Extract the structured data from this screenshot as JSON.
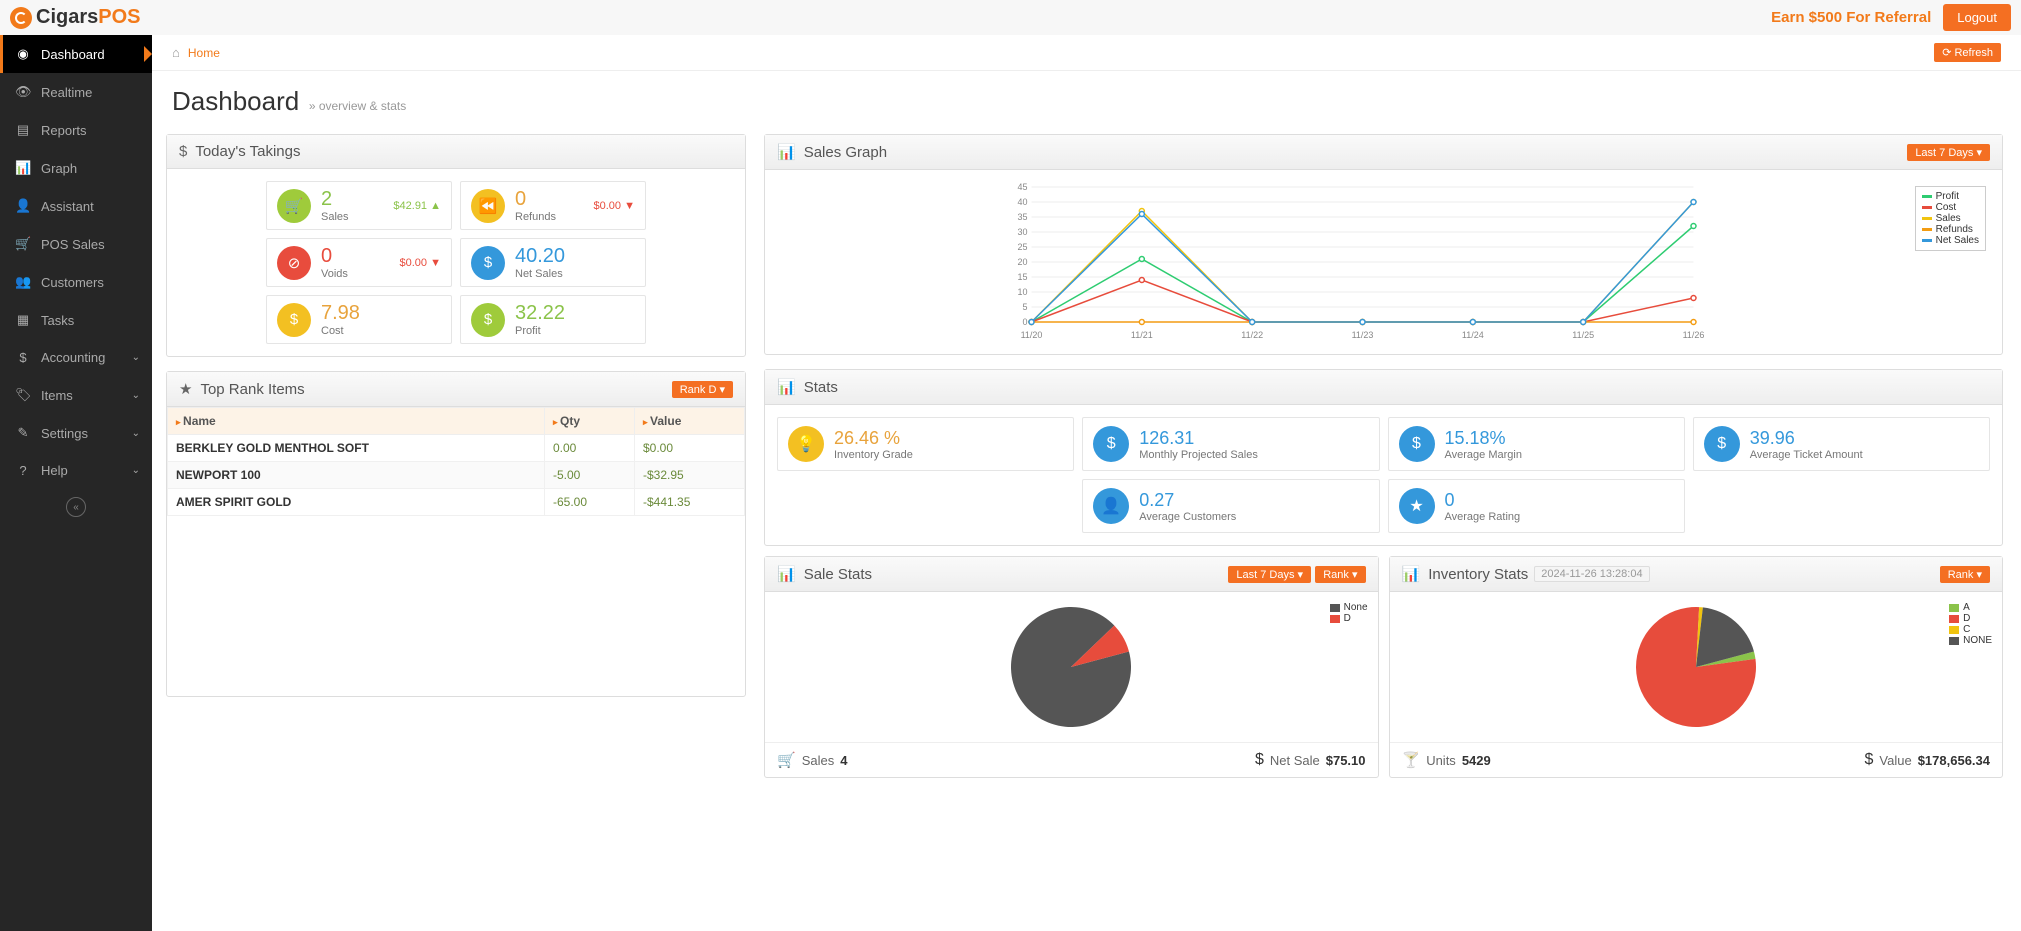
{
  "brand": {
    "text1": "Cigars",
    "text2": "POS"
  },
  "topbar": {
    "referral": "Earn $500 For Referral",
    "logout": "Logout"
  },
  "breadcrumb": {
    "home": "Home"
  },
  "refresh_label": "Refresh",
  "page": {
    "title": "Dashboard",
    "subtitle": "» overview & stats"
  },
  "sidebar": {
    "items": [
      {
        "icon": "dashboard",
        "label": "Dashboard",
        "active": true
      },
      {
        "icon": "eye",
        "label": "Realtime"
      },
      {
        "icon": "report",
        "label": "Reports"
      },
      {
        "icon": "bars",
        "label": "Graph"
      },
      {
        "icon": "user",
        "label": "Assistant"
      },
      {
        "icon": "cart",
        "label": "POS Sales"
      },
      {
        "icon": "users",
        "label": "Customers"
      },
      {
        "icon": "tasks",
        "label": "Tasks"
      },
      {
        "icon": "dollar",
        "label": "Accounting",
        "chev": true
      },
      {
        "icon": "tag",
        "label": "Items",
        "chev": true
      },
      {
        "icon": "edit",
        "label": "Settings",
        "chev": true
      },
      {
        "icon": "help",
        "label": "Help",
        "chev": true
      }
    ]
  },
  "takings": {
    "title": "Today's Takings",
    "tiles": [
      {
        "ico": "cart",
        "ico_cls": "ico-green",
        "val": "2",
        "val_cls": "val-green",
        "lbl": "Sales",
        "side": "$42.91",
        "side_cls": "up",
        "arrow": "▲"
      },
      {
        "ico": "rewind",
        "ico_cls": "ico-yellow",
        "val": "0",
        "val_cls": "val-yellow",
        "lbl": "Refunds",
        "side": "$0.00",
        "side_cls": "down",
        "arrow": "▼"
      },
      {
        "ico": "ban",
        "ico_cls": "ico-red",
        "val": "0",
        "val_cls": "val-red",
        "lbl": "Voids",
        "side": "$0.00",
        "side_cls": "down",
        "arrow": "▼"
      },
      {
        "ico": "dollar",
        "ico_cls": "ico-blue",
        "val": "40.20",
        "val_cls": "val-blue",
        "lbl": "Net Sales"
      },
      {
        "ico": "dollar",
        "ico_cls": "ico-yellow",
        "val": "7.98",
        "val_cls": "val-yellow",
        "lbl": "Cost"
      },
      {
        "ico": "dollar",
        "ico_cls": "ico-green",
        "val": "32.22",
        "val_cls": "val-green",
        "lbl": "Profit"
      }
    ]
  },
  "sales_graph": {
    "title": "Sales Graph",
    "range_btn": "Last 7 Days",
    "legend": [
      "Profit",
      "Cost",
      "Sales",
      "Refunds",
      "Net Sales"
    ]
  },
  "chart_data": [
    {
      "type": "line",
      "title": "Sales Graph",
      "categories": [
        "11/20",
        "11/21",
        "11/22",
        "11/23",
        "11/24",
        "11/25",
        "11/26"
      ],
      "ylim": [
        0,
        45
      ],
      "series": [
        {
          "name": "Profit",
          "color": "#2ecc71",
          "values": [
            0,
            21,
            0,
            0,
            0,
            0,
            32
          ]
        },
        {
          "name": "Cost",
          "color": "#e74c3c",
          "values": [
            0,
            14,
            0,
            0,
            0,
            0,
            8
          ]
        },
        {
          "name": "Sales",
          "color": "#f1c40f",
          "values": [
            0,
            37,
            0,
            0,
            0,
            0,
            40
          ]
        },
        {
          "name": "Refunds",
          "color": "#f39c12",
          "values": [
            0,
            0,
            0,
            0,
            0,
            0,
            0
          ]
        },
        {
          "name": "Net Sales",
          "color": "#3498db",
          "values": [
            0,
            36,
            0,
            0,
            0,
            0,
            40
          ]
        }
      ]
    },
    {
      "type": "pie",
      "title": "Sale Stats",
      "series": [
        {
          "name": "None",
          "color": "#555",
          "value": 92
        },
        {
          "name": "D",
          "color": "#e74c3c",
          "value": 8
        }
      ]
    },
    {
      "type": "pie",
      "title": "Inventory Stats",
      "series": [
        {
          "name": "A",
          "color": "#8bc34a",
          "value": 2
        },
        {
          "name": "D",
          "color": "#e74c3c",
          "value": 78
        },
        {
          "name": "C",
          "color": "#f1c40f",
          "value": 1
        },
        {
          "name": "NONE",
          "color": "#555",
          "value": 19
        }
      ]
    }
  ],
  "top_rank": {
    "title": "Top Rank Items",
    "btn": "Rank D",
    "columns": [
      "Name",
      "Qty",
      "Value"
    ],
    "rows": [
      {
        "name": "BERKLEY GOLD MENTHOL SOFT",
        "qty": "0.00",
        "value": "$0.00"
      },
      {
        "name": "NEWPORT 100",
        "qty": "-5.00",
        "value": "-$32.95"
      },
      {
        "name": "AMER SPIRIT GOLD",
        "qty": "-65.00",
        "value": "-$441.35"
      }
    ]
  },
  "stats": {
    "title": "Stats",
    "tiles_top": [
      {
        "ico": "bulb",
        "ico_cls": "ico-yellow",
        "val": "26.46 %",
        "val_cls": "val-yellow",
        "lbl": "Inventory Grade"
      },
      {
        "ico": "dollar",
        "ico_cls": "ico-blue",
        "val": "126.31",
        "val_cls": "val-blue",
        "lbl": "Monthly Projected Sales"
      },
      {
        "ico": "dollar",
        "ico_cls": "ico-blue",
        "val": "15.18%",
        "val_cls": "val-blue",
        "lbl": "Average Margin"
      },
      {
        "ico": "dollar",
        "ico_cls": "ico-blue",
        "val": "39.96",
        "val_cls": "val-blue",
        "lbl": "Average Ticket Amount"
      }
    ],
    "tiles_bottom": [
      {
        "ico": "user",
        "ico_cls": "ico-blue",
        "val": "0.27",
        "val_cls": "val-blue",
        "lbl": "Average Customers"
      },
      {
        "ico": "star",
        "ico_cls": "ico-blue",
        "val": "0",
        "val_cls": "val-blue",
        "lbl": "Average Rating"
      }
    ]
  },
  "sale_stats": {
    "title": "Sale Stats",
    "range_btn": "Last 7 Days",
    "rank_btn": "Rank",
    "legend": [
      {
        "name": "None",
        "color": "#555"
      },
      {
        "name": "D",
        "color": "#e74c3c"
      }
    ],
    "footer": {
      "l_lbl": "Sales",
      "l_val": "4",
      "r_lbl": "Net Sale",
      "r_val": "$75.10"
    }
  },
  "inventory_stats": {
    "title": "Inventory Stats",
    "timestamp": "2024-11-26 13:28:04",
    "rank_btn": "Rank",
    "legend": [
      {
        "name": "A",
        "color": "#8bc34a"
      },
      {
        "name": "D",
        "color": "#e74c3c"
      },
      {
        "name": "C",
        "color": "#f1c40f"
      },
      {
        "name": "NONE",
        "color": "#555"
      }
    ],
    "footer": {
      "l_lbl": "Units",
      "l_val": "5429",
      "r_lbl": "Value",
      "r_val": "$178,656.34"
    }
  }
}
